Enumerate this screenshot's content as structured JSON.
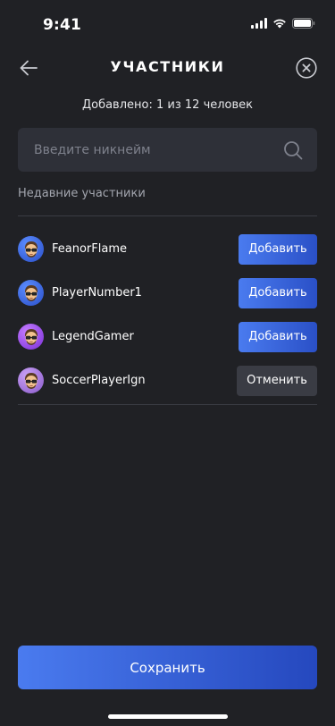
{
  "status_bar": {
    "time": "9:41",
    "icons": [
      "signal-icon",
      "wifi-icon",
      "battery-icon"
    ]
  },
  "header": {
    "back_icon": "arrow-left-icon",
    "title": "УЧАСТНИКИ",
    "close_icon": "close-circle-icon"
  },
  "added_count": "Добавлено: 1 из 12 человек",
  "search": {
    "placeholder": "Введите никнейм",
    "value": "",
    "icon": "search-icon"
  },
  "section_label": "Недавние участники",
  "participants": [
    {
      "name": "FeanorFlame",
      "action_label": "Добавить",
      "action": "add",
      "avatar_color": "#3E6BE6"
    },
    {
      "name": "PlayerNumber1",
      "action_label": "Добавить",
      "action": "add",
      "avatar_color": "#3E6BE6"
    },
    {
      "name": "LegendGamer",
      "action_label": "Добавить",
      "action": "add",
      "avatar_color": "#9B4DEB"
    },
    {
      "name": "SoccerPlayerIgn",
      "action_label": "Отменить",
      "action": "cancel",
      "avatar_color": "#A77DE0"
    }
  ],
  "save_label": "Сохранить",
  "colors": {
    "background": "#202125",
    "input_background": "#2E3038",
    "accent_start": "#4A7BEF",
    "accent_end": "#2548BE",
    "cancel_background": "#3A3C44",
    "divider": "#3A3C44",
    "muted_text": "#A3A6AF"
  }
}
